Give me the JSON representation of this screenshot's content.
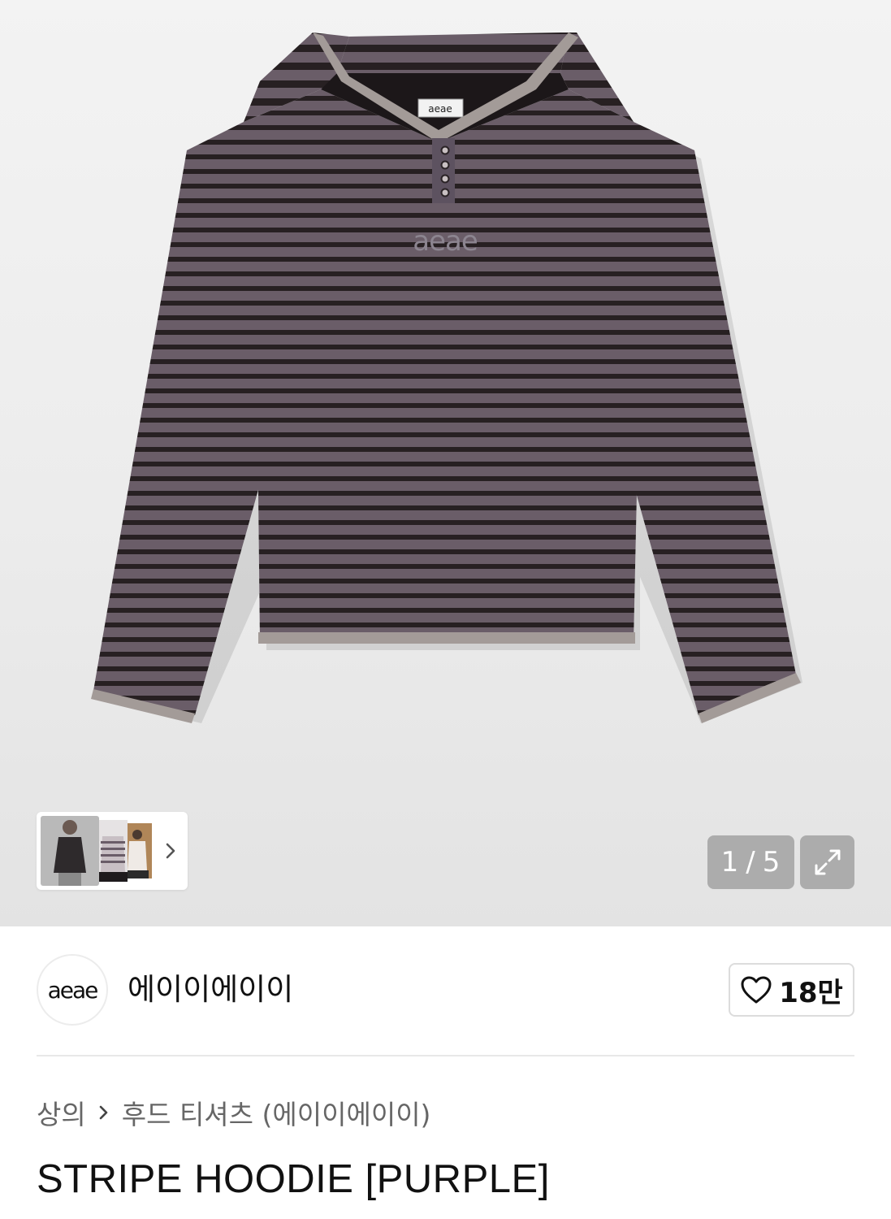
{
  "gallery": {
    "counter_current": "1",
    "counter_separator": "/",
    "counter_total": "5",
    "tag_text": "aeae",
    "print_text": "aeae",
    "thumbnails": [
      {
        "name": "model-front"
      },
      {
        "name": "model-side"
      },
      {
        "name": "model-back"
      }
    ]
  },
  "brand": {
    "logo_text": "aeae",
    "name": "에이이에이이",
    "like_count": "18만"
  },
  "breadcrumb": {
    "category": "상의",
    "subcategory": "후드 티셔츠 (에이이에이이)"
  },
  "product": {
    "title": "STRIPE HOODIE [PURPLE]"
  },
  "colors": {
    "stripe_light": "#6a5d68",
    "stripe_dark": "#272022",
    "trim": "#a39b98"
  },
  "icons": {
    "thumbnail_next": "chevron-right-icon",
    "expand": "expand-icon",
    "like": "heart-outline-icon",
    "breadcrumb_separator": "chevron-right-icon"
  }
}
